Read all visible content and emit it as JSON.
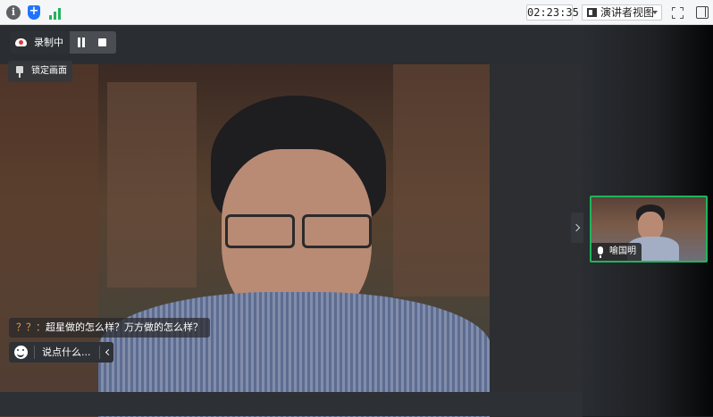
{
  "toolbar": {
    "timer": "02:23:35",
    "view_mode": "演讲者视图",
    "icons": [
      "info-icon",
      "shield-icon",
      "signal-icon",
      "presenter-view-icon",
      "fullscreen-icon",
      "panel-toggle-icon"
    ]
  },
  "recording": {
    "status": "录制中",
    "icons": [
      "cloud-record-icon",
      "pause-icon",
      "stop-icon"
    ]
  },
  "lock_view": {
    "label": "锁定画面"
  },
  "chat": {
    "sender": "？？",
    "separator": "：",
    "message": "超星做的怎么样？万方做的怎么样？",
    "input_placeholder": "说点什么..."
  },
  "participant": {
    "name": "喻国明"
  },
  "colors": {
    "accent_green": "#1fb55c",
    "record_red": "#e6363b",
    "sender_orange": "#f0a04b",
    "shield_blue": "#1f74ff"
  }
}
